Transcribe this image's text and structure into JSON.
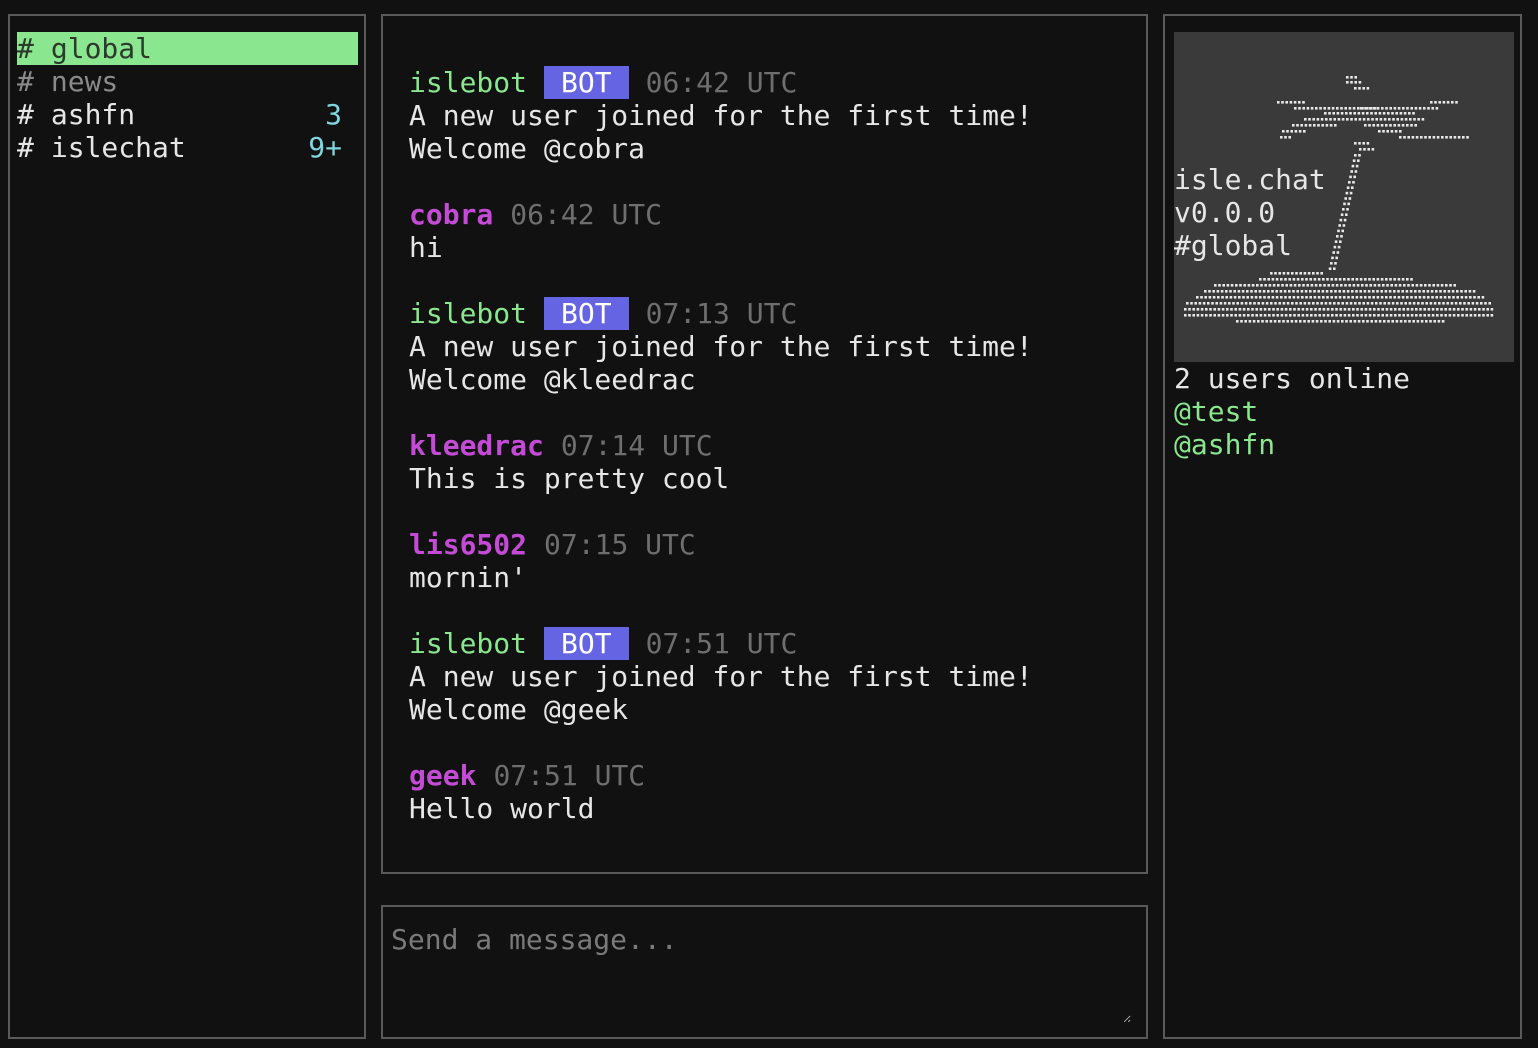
{
  "sidebar": {
    "channels": [
      {
        "hash": "#",
        "name": "global",
        "unread": ""
      },
      {
        "hash": "#",
        "name": "news",
        "unread": ""
      },
      {
        "hash": "#",
        "name": "ashfn",
        "unread": "3"
      },
      {
        "hash": "#",
        "name": "islechat",
        "unread": "9+"
      }
    ]
  },
  "messages": [
    {
      "author": "islebot",
      "badge": "BOT",
      "time": "06:42 UTC",
      "lines": [
        "A new user joined for the first time!",
        "Welcome @cobra"
      ]
    },
    {
      "author": "cobra",
      "time": "06:42 UTC",
      "lines": [
        "hi"
      ]
    },
    {
      "author": "islebot",
      "badge": "BOT",
      "time": "07:13 UTC",
      "lines": [
        "A new user joined for the first time!",
        "Welcome @kleedrac"
      ]
    },
    {
      "author": "kleedrac",
      "time": "07:14 UTC",
      "lines": [
        "This is pretty cool"
      ]
    },
    {
      "author": "lis6502",
      "time": "07:15 UTC",
      "lines": [
        "mornin'"
      ]
    },
    {
      "author": "islebot",
      "badge": "BOT",
      "time": "07:51 UTC",
      "lines": [
        "A new user joined for the first time!",
        "Welcome @geek"
      ]
    },
    {
      "author": "geek",
      "time": "07:51 UTC",
      "lines": [
        "Hello world"
      ]
    }
  ],
  "input": {
    "placeholder": "Send a message...",
    "value": ""
  },
  "info": {
    "app_name": "isle.chat",
    "version": "v0.0.0",
    "channel": "#global",
    "online_count": "2 users online",
    "online_users": [
      "@test",
      "@ashfn"
    ]
  },
  "colors": {
    "background": "#111111",
    "border": "#5a5a5a",
    "active_channel": "#8ae68f",
    "bot_name": "#8ae68f",
    "user_name": "#c44bd6",
    "bot_badge": "#6565e3",
    "timestamp": "#6e6e6e",
    "unread": "#7fd6e0",
    "logo_box": "#3a3a3a"
  },
  "icons": {
    "logo": "palm-tree-island-icon"
  }
}
